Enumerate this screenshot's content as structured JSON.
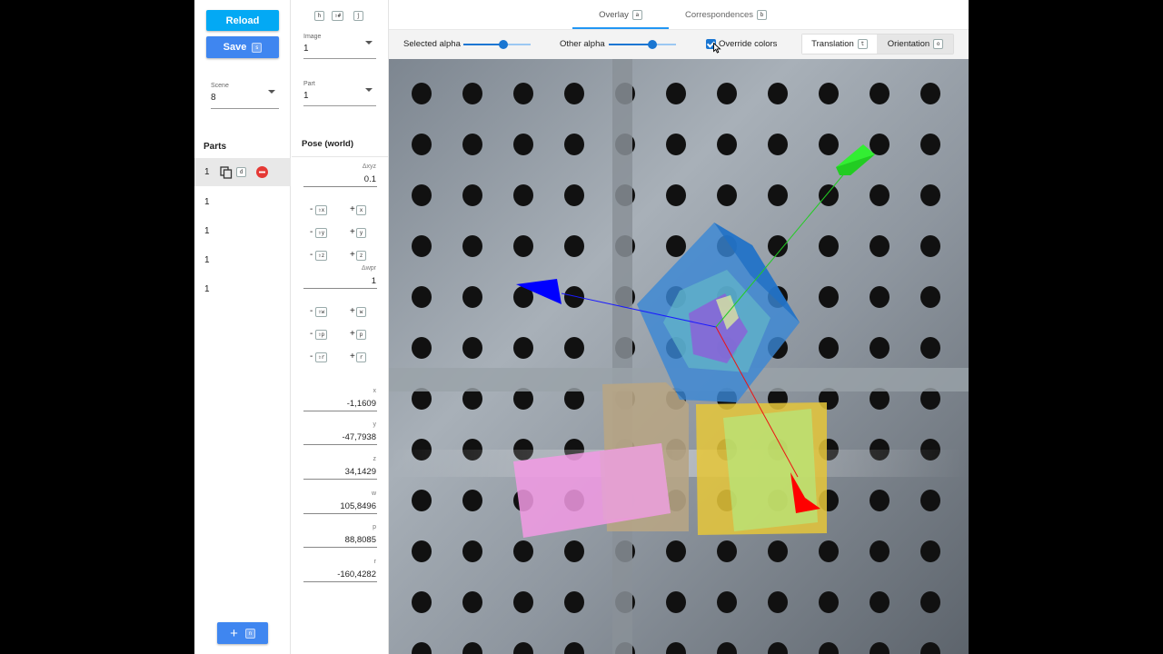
{
  "left": {
    "reload_label": "Reload",
    "save_label": "Save",
    "save_key": "s",
    "scene": {
      "label": "Scene",
      "value": "8"
    },
    "parts_title": "Parts",
    "parts": [
      "1",
      "1",
      "1",
      "1",
      "1"
    ],
    "duplicate_key": "d",
    "add_label": "+",
    "add_key": "n"
  },
  "middle": {
    "nav_keys": [
      "h",
      "⇧#",
      "j"
    ],
    "image": {
      "label": "Image",
      "value": "1"
    },
    "part": {
      "label": "Part",
      "value": "1"
    },
    "pose_title": "Pose (world)",
    "dxyz": {
      "label": "Δxyz",
      "value": "0.1"
    },
    "dwpr": {
      "label": "Δwpr",
      "value": "1"
    },
    "translate_steps": [
      {
        "minus": "-",
        "minus_key": "⇧x",
        "plus": "+",
        "plus_key": "x"
      },
      {
        "minus": "-",
        "minus_key": "⇧y",
        "plus": "+",
        "plus_key": "y"
      },
      {
        "minus": "-",
        "minus_key": "⇧z",
        "plus": "+",
        "plus_key": "z"
      }
    ],
    "rotate_steps": [
      {
        "minus": "-",
        "minus_key": "⇧w",
        "plus": "+",
        "plus_key": "w"
      },
      {
        "minus": "-",
        "minus_key": "⇧p",
        "plus": "+",
        "plus_key": "p"
      },
      {
        "minus": "-",
        "minus_key": "⇧r",
        "plus": "+",
        "plus_key": "r"
      }
    ],
    "pose_values": [
      {
        "label": "x",
        "value": "-1,1609"
      },
      {
        "label": "y",
        "value": "-47,7938"
      },
      {
        "label": "z",
        "value": "34,1429"
      },
      {
        "label": "w",
        "value": "105,8496"
      },
      {
        "label": "p",
        "value": "88,8085"
      },
      {
        "label": "r",
        "value": "-160,4282"
      }
    ]
  },
  "tabs": [
    {
      "label": "Overlay",
      "key": "a"
    },
    {
      "label": "Correspondences",
      "key": "b"
    }
  ],
  "toolbar": {
    "selected_alpha_label": "Selected alpha",
    "selected_alpha": 0.6,
    "other_alpha_label": "Other alpha",
    "other_alpha": 0.65,
    "override_label": "Override colors",
    "override_checked": true,
    "translation_label": "Translation",
    "translation_key": "t",
    "orientation_label": "Orientation",
    "orientation_key": "o"
  },
  "colors": {
    "reload": "#03a9f4",
    "save": "#3f86f0",
    "add": "#3f86f0",
    "accent": "#1976d2",
    "remove": "#e53935"
  }
}
